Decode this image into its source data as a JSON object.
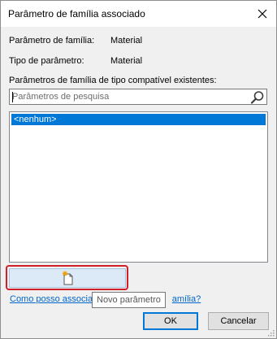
{
  "window": {
    "title": "Parâmetro de família associado",
    "close_glyph": "✕"
  },
  "info": {
    "family_param_label": "Parâmetro de família:",
    "family_param_value": "Material",
    "param_type_label": "Tipo de parâmetro:",
    "param_type_value": "Material",
    "existing_label": "Parâmetros de família de tipo compatível existentes:"
  },
  "search": {
    "placeholder": "Parâmetros de pesquisa",
    "value": "",
    "icon": "magnifier-icon"
  },
  "list": {
    "items": [
      "<nenhum>"
    ],
    "selected_index": 0,
    "selected_color": "#0078d7"
  },
  "new_param_button": {
    "icon": "new-document-sparkle-icon",
    "tooltip": "Novo parâmetro",
    "highlight_color": "#d0202a"
  },
  "help_link": {
    "text_before": "Como posso associar",
    "text_after": "amília?",
    "color": "#0066cc"
  },
  "buttons": {
    "ok": "OK",
    "cancel": "Cancelar"
  }
}
